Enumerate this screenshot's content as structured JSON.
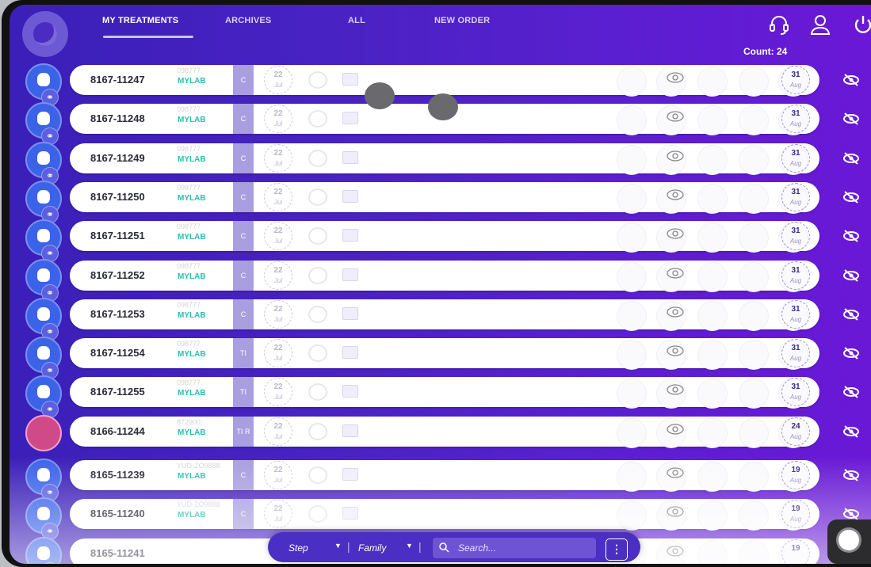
{
  "nav": {
    "tabs": [
      {
        "label": "MY TREATMENTS",
        "active": true
      },
      {
        "label": "ARCHIVES",
        "active": false
      },
      {
        "label": "ALL",
        "active": false
      },
      {
        "label": "NEW ORDER",
        "active": false
      }
    ],
    "icons": [
      "headset-icon",
      "user-icon",
      "power-icon"
    ]
  },
  "count_label": "Count: 24",
  "rows": [
    {
      "code": "8167-11247",
      "ref": "098777",
      "lab": "MYLAB",
      "strip": "C",
      "start_day": "22",
      "start_month": "Jul",
      "end_day": "31",
      "end_month": "Aug"
    },
    {
      "code": "8167-11248",
      "ref": "098777",
      "lab": "MYLAB",
      "strip": "C",
      "start_day": "22",
      "start_month": "Jul",
      "end_day": "31",
      "end_month": "Aug"
    },
    {
      "code": "8167-11249",
      "ref": "098777",
      "lab": "MYLAB",
      "strip": "C",
      "start_day": "22",
      "start_month": "Jul",
      "end_day": "31",
      "end_month": "Aug"
    },
    {
      "code": "8167-11250",
      "ref": "098777",
      "lab": "MYLAB",
      "strip": "C",
      "start_day": "22",
      "start_month": "Jul",
      "end_day": "31",
      "end_month": "Aug"
    },
    {
      "code": "8167-11251",
      "ref": "098777",
      "lab": "MYLAB",
      "strip": "C",
      "start_day": "22",
      "start_month": "Jul",
      "end_day": "31",
      "end_month": "Aug"
    },
    {
      "code": "8167-11252",
      "ref": "098777",
      "lab": "MYLAB",
      "strip": "C",
      "start_day": "22",
      "start_month": "Jul",
      "end_day": "31",
      "end_month": "Aug"
    },
    {
      "code": "8167-11253",
      "ref": "098777",
      "lab": "MYLAB",
      "strip": "C",
      "start_day": "22",
      "start_month": "Jul",
      "end_day": "31",
      "end_month": "Aug"
    },
    {
      "code": "8167-11254",
      "ref": "098777",
      "lab": "MYLAB",
      "strip": "TI",
      "start_day": "22",
      "start_month": "Jul",
      "end_day": "31",
      "end_month": "Aug"
    },
    {
      "code": "8167-11255",
      "ref": "098777",
      "lab": "MYLAB",
      "strip": "TI",
      "start_day": "22",
      "start_month": "Jul",
      "end_day": "31",
      "end_month": "Aug"
    },
    {
      "code": "8166-11244",
      "ref": "872900",
      "lab": "MYLAB",
      "strip": "TI R",
      "start_day": "22",
      "start_month": "Jul",
      "end_day": "24",
      "end_month": "Aug"
    },
    {
      "code": "8165-11239",
      "ref": "YUD-ZO9888",
      "lab": "MYLAB",
      "strip": "C",
      "start_day": "22",
      "start_month": "Jul",
      "end_day": "19",
      "end_month": "Aug"
    },
    {
      "code": "8165-11240",
      "ref": "YUD-ZO9888",
      "lab": "MYLAB",
      "strip": "C",
      "start_day": "22",
      "start_month": "Jul",
      "end_day": "19",
      "end_month": "Aug"
    },
    {
      "code": "8165-11241",
      "ref": "",
      "lab": "",
      "strip": "",
      "start_day": "",
      "start_month": "",
      "end_day": "19",
      "end_month": ""
    }
  ],
  "bottom": {
    "step_label": "Step",
    "family_label": "Family",
    "search_placeholder": "Search...",
    "more_label": "⋮"
  },
  "colors": {
    "accent": "#4a22c4",
    "lab_text": "#2bbfae",
    "avatar": "#3b63e8"
  }
}
